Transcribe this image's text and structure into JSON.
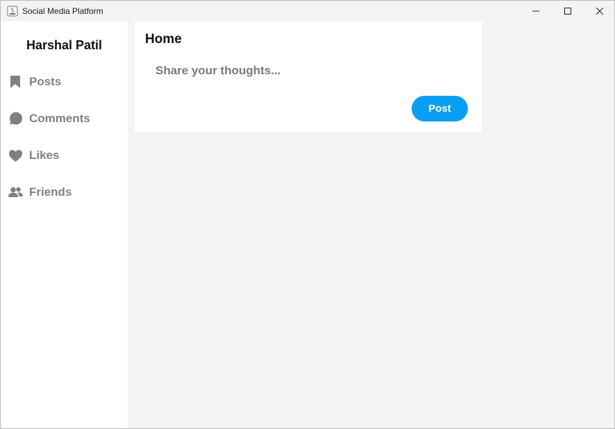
{
  "window": {
    "title": "Social Media Platform"
  },
  "sidebar": {
    "user_name": "Harshal Patil",
    "items": [
      {
        "label": "Posts",
        "icon": "bookmark-icon"
      },
      {
        "label": "Comments",
        "icon": "speech-bubble-icon"
      },
      {
        "label": "Likes",
        "icon": "heart-icon"
      },
      {
        "label": "Friends",
        "icon": "people-icon"
      }
    ]
  },
  "main": {
    "title": "Home",
    "composer": {
      "value": "",
      "placeholder": "Share your thoughts...",
      "post_label": "Post"
    }
  },
  "colors": {
    "accent": "#0a9ff0",
    "nav_text": "#808080",
    "background": "#f4f4f4"
  }
}
